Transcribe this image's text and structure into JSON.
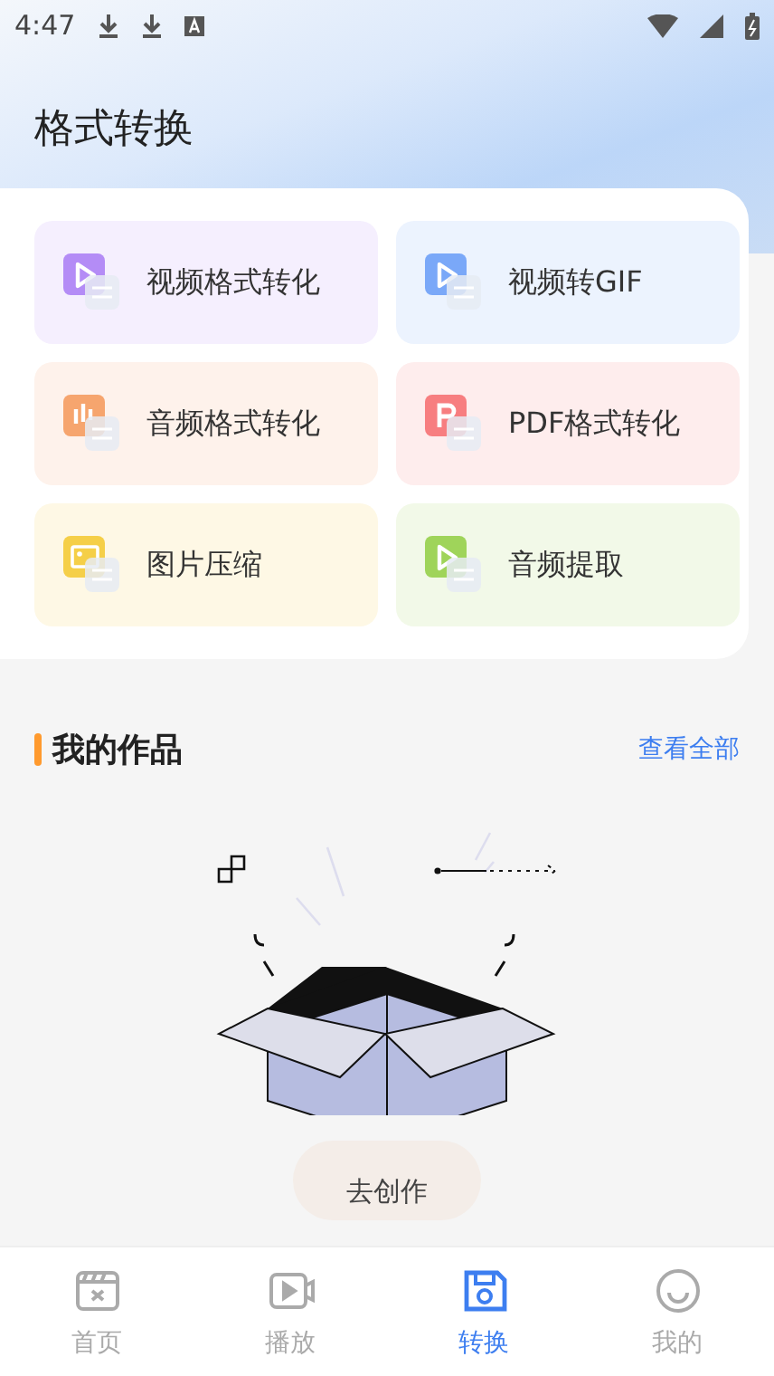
{
  "status_bar": {
    "time": "4:47"
  },
  "title": "格式转换",
  "tools": [
    {
      "label": "视频格式转化",
      "kind": "video-convert",
      "color": "#b48cf6"
    },
    {
      "label": "视频转GIF",
      "kind": "video-gif",
      "color": "#7aa8f8"
    },
    {
      "label": "音频格式转化",
      "kind": "audio-convert",
      "color": "#f6a56e"
    },
    {
      "label": "PDF格式转化",
      "kind": "pdf",
      "color": "#f77e80"
    },
    {
      "label": "图片压缩",
      "kind": "image-compress",
      "color": "#f5cf48"
    },
    {
      "label": "音频提取",
      "kind": "audio-extract",
      "color": "#9fd45a"
    }
  ],
  "works": {
    "title": "我的作品",
    "view_all": "查看全部",
    "create_button": "去创作"
  },
  "nav": [
    {
      "label": "首页",
      "kind": "home",
      "selected": false
    },
    {
      "label": "播放",
      "kind": "play",
      "selected": false
    },
    {
      "label": "转换",
      "kind": "convert",
      "selected": true
    },
    {
      "label": "我的",
      "kind": "mine",
      "selected": false
    }
  ]
}
